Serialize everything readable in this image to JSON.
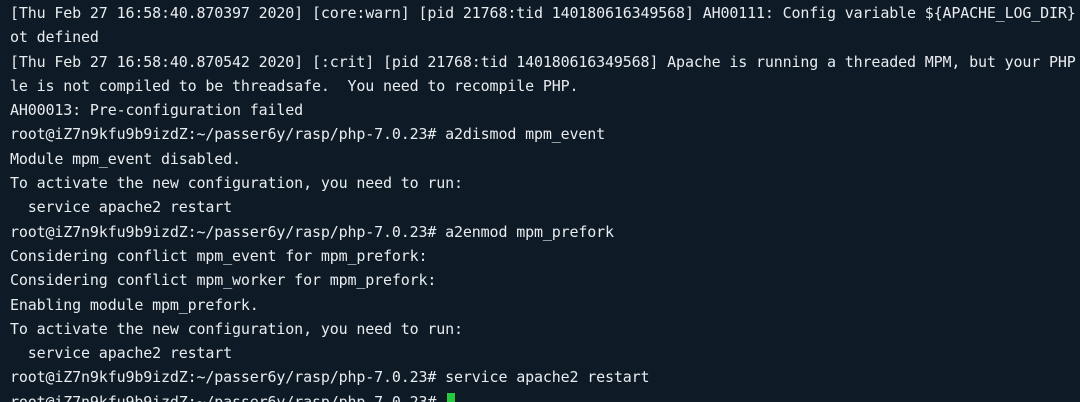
{
  "terminal": {
    "lines": [
      "[Thu Feb 27 16:58:40.870397 2020] [core:warn] [pid 21768:tid 140180616349568] AH00111: Config variable ${APACHE_LOG_DIR} is n",
      "ot defined",
      "[Thu Feb 27 16:58:40.870542 2020] [:crit] [pid 21768:tid 140180616349568] Apache is running a threaded MPM, but your PHP Modu",
      "le is not compiled to be threadsafe.  You need to recompile PHP.",
      "AH00013: Pre-configuration failed",
      "root@iZ7n9kfu9b9izdZ:~/passer6y/rasp/php-7.0.23# a2dismod mpm_event",
      "Module mpm_event disabled.",
      "To activate the new configuration, you need to run:",
      "  service apache2 restart",
      "root@iZ7n9kfu9b9izdZ:~/passer6y/rasp/php-7.0.23# a2enmod mpm_prefork",
      "Considering conflict mpm_event for mpm_prefork:",
      "Considering conflict mpm_worker for mpm_prefork:",
      "Enabling module mpm_prefork.",
      "To activate the new configuration, you need to run:",
      "  service apache2 restart",
      "root@iZ7n9kfu9b9izdZ:~/passer6y/rasp/php-7.0.23# service apache2 restart"
    ],
    "current_prompt": "root@iZ7n9kfu9b9izdZ:~/passer6y/rasp/php-7.0.23# ",
    "colors": {
      "background": "#0e1a26",
      "text": "#e8ecef",
      "cursor": "#27c93f"
    }
  }
}
